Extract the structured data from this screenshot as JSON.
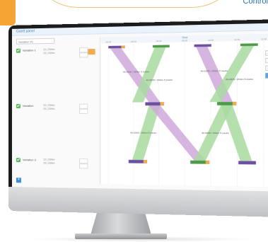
{
  "corner": {
    "text": "Control"
  },
  "app": {
    "title": "Gantt panel"
  },
  "left_panel": {
    "dropdown_value": "Variation #1",
    "rows": [
      {
        "label": "Variation 1",
        "values": [
          "10 | 20/km",
          "15 | 20/km"
        ]
      },
      {
        "label": "Variation",
        "values": [
          "10 | 20/km",
          "15 | 20/km"
        ]
      },
      {
        "label": "Variation 3",
        "values": [
          "10 | 20/km",
          "15 | 20/km"
        ]
      }
    ],
    "add_button": "+"
  },
  "chart": {
    "axis_title": "Time",
    "header_ticks": [
      "08:00",
      "08:30",
      "09:00",
      "09:30",
      "10:00",
      "10:30",
      "11:00"
    ],
    "band_labels": [
      "40-0005 / 20/km 5 tracks",
      "40-0005 / 20/km 5 tracks",
      "40-0005 / 20/km 5 tracks",
      "40-0005 / 20/km 5 tracks",
      "40-0005 / 20/km 5 tracks",
      "40-0005 / 20/km 5 tracks"
    ]
  },
  "tools": {
    "items": [
      "+",
      "-",
      "+",
      "≡"
    ]
  },
  "colors": {
    "purple_band": "#cfa8db",
    "green_band": "#a8dba0",
    "accent_orange": "#f0ad4e",
    "accent_blue": "#3a8fd9"
  }
}
